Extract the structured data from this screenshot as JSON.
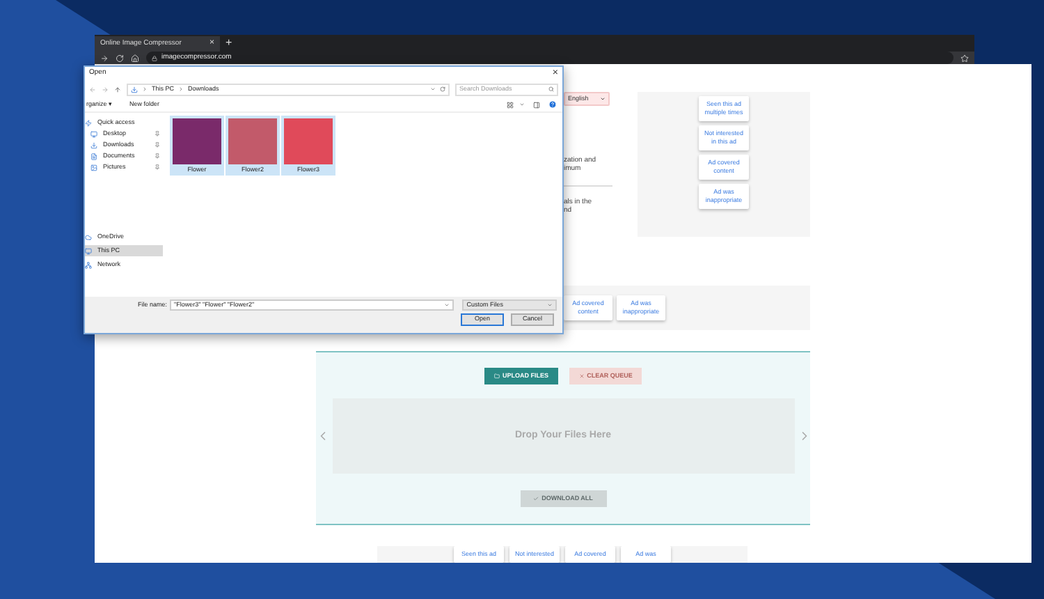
{
  "browser": {
    "tab_title": "Online Image Compressor",
    "tab_close": "×",
    "new_tab": "+",
    "address": "imagecompressor.com"
  },
  "page": {
    "language": "English",
    "text_lines": [
      "zation and",
      "imum"
    ],
    "text_lines_2": [
      "als in the",
      "nd"
    ],
    "ad_panel": [
      "Seen this ad multiple times",
      "Not interested in this ad",
      "Ad covered content",
      "Ad was inappropriate"
    ],
    "ad_strip": [
      "Ad covered content",
      "Ad was inappropriate"
    ],
    "upload": {
      "upload_button": "UPLOAD FILES",
      "clear_button": {
        "label": "CLEAR QUEUE",
        "disabled": true
      },
      "drop_text": "Drop Your Files Here",
      "download_button": {
        "label": "DOWNLOAD ALL",
        "disabled": true
      }
    },
    "bottom_strip": [
      "Seen this ad",
      "Not interested",
      "Ad covered",
      "Ad was"
    ]
  },
  "dialog": {
    "title": "Open",
    "close": "×",
    "breadcrumb": [
      "This PC",
      "Downloads"
    ],
    "search": {
      "placeholder": "Search Downloads"
    },
    "toolbar": [
      "rganize ▾",
      "New folder"
    ],
    "nav": [
      {
        "label": "Quick access",
        "selected": false,
        "children": [
          {
            "label": "Desktop",
            "pinned": true,
            "selected": false
          },
          {
            "label": "Downloads",
            "pinned": true,
            "selected": false
          },
          {
            "label": "Documents",
            "pinned": true,
            "selected": false
          },
          {
            "label": "Pictures",
            "pinned": true,
            "selected": false
          }
        ]
      },
      {
        "label": "OneDrive",
        "selected": false
      },
      {
        "label": "This PC",
        "selected": true
      },
      {
        "label": "Network",
        "selected": false
      }
    ],
    "files": [
      {
        "name": "Flower",
        "selected": true,
        "color": "#7a2a6a"
      },
      {
        "name": "Flower2",
        "selected": true,
        "color": "#c25a6a"
      },
      {
        "name": "Flower3",
        "selected": true,
        "color": "#e04a5a"
      }
    ],
    "file_name_label": "File name:",
    "file_name": "\"Flower3\" \"Flower\" \"Flower2\"",
    "file_type": "Custom Files",
    "buttons": [
      "Open",
      "Cancel"
    ]
  }
}
